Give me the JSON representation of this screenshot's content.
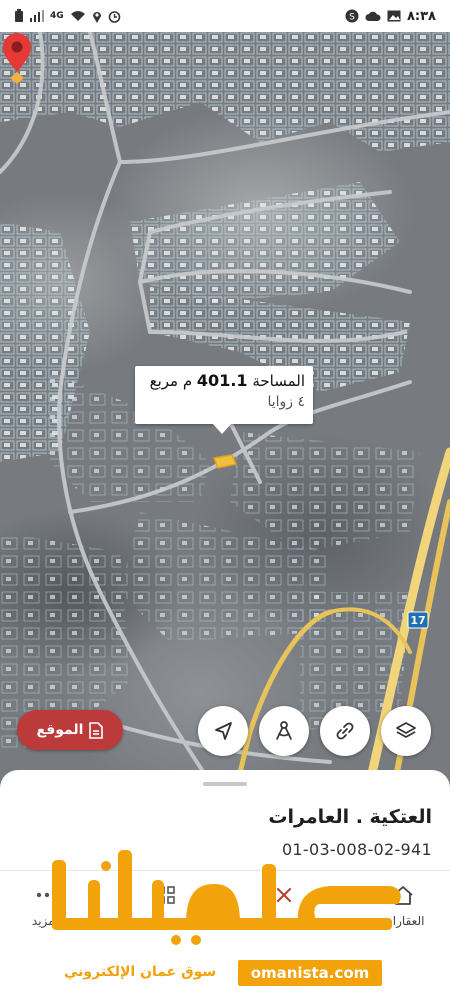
{
  "status_bar": {
    "time": "٨:٣٨",
    "network": "4G",
    "icons": [
      "battery-icon",
      "signal-icon",
      "wifi-icon",
      "location-icon",
      "alarm-icon",
      "shazam-icon",
      "cloud-icon",
      "gallery-icon"
    ]
  },
  "map": {
    "popup": {
      "area_label": "المساحة",
      "area_value": "401.1",
      "area_unit": "م مربع",
      "corners": "٤ زوايا"
    },
    "road_shield": "17",
    "location_button_label": "الموقع",
    "buttons": [
      "navigate-icon",
      "measure-icon",
      "link-icon",
      "layers-icon"
    ]
  },
  "sheet": {
    "place_name": "العتكية . العامرات",
    "parcel_code": "01-03-008-02-941"
  },
  "nav": {
    "items": [
      {
        "label": "المزيد",
        "icon": "more-icon"
      },
      {
        "label": "",
        "icon": "grid-icon"
      },
      {
        "label": "",
        "icon": "tools-icon"
      },
      {
        "label": "العقارات",
        "icon": "home-icon"
      }
    ]
  },
  "watermark": {
    "logo_text": "عمانيستا",
    "tagline": "سوق عمان الإلكتروني",
    "domain": "omanista.com"
  },
  "colors": {
    "accent_red": "#bd3a3a",
    "watermark_orange": "#f2a20a",
    "road_yellow": "#e8c35a"
  }
}
